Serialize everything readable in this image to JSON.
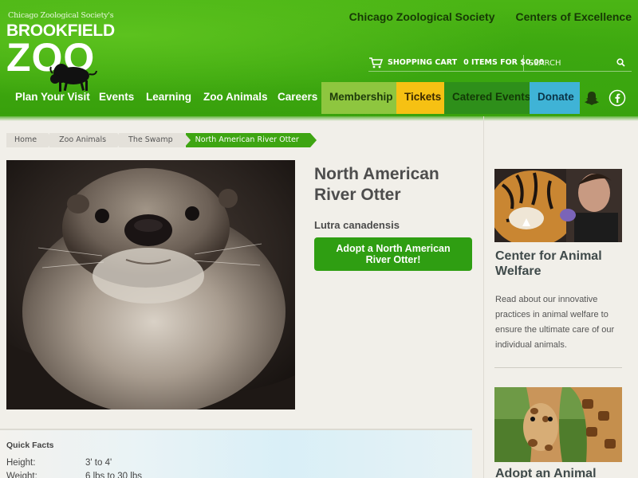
{
  "header": {
    "logo_subtitle": "Chicago Zoological Society's",
    "logo_brookfield": "BROOKFIELD",
    "logo_zoo": "ZOO",
    "top_links": [
      "Chicago Zoological Society",
      "Centers of Excellence"
    ],
    "cart_label": "SHOPPING CART",
    "cart_status": "0 ITEMS FOR $0.00",
    "search_placeholder": "SEARCH"
  },
  "nav": {
    "items": [
      "Plan Your Visit",
      "Events",
      "Learning",
      "Zoo Animals",
      "Careers",
      "Membership",
      "Tickets",
      "Catered Events",
      "Donate"
    ],
    "social": [
      "snapchat-icon",
      "facebook-icon"
    ],
    "colors": {
      "membership": "#8ec63f",
      "tickets": "#f6c113",
      "catered": "#2e8f1a",
      "donate": "#3fb3d6"
    }
  },
  "breadcrumb": [
    "Home",
    "Zoo Animals",
    "The Swamp",
    "North American River Otter"
  ],
  "animal": {
    "title": "North American River Otter",
    "scientific_name": "Lutra canadensis",
    "adopt_label": "Adopt a North American River Otter!"
  },
  "quick_facts": {
    "title": "Quick Facts",
    "rows": [
      {
        "label": "Height:",
        "value": "3' to 4'"
      },
      {
        "label": "Weight:",
        "value": "6 lbs to 30 lbs"
      }
    ]
  },
  "sidebar": {
    "card1_title": "Center for Animal Welfare",
    "card1_text": "Read about our innovative practices in animal welfare to ensure the ultimate care of our individual animals.",
    "card2_title": "Adopt an Animal"
  }
}
